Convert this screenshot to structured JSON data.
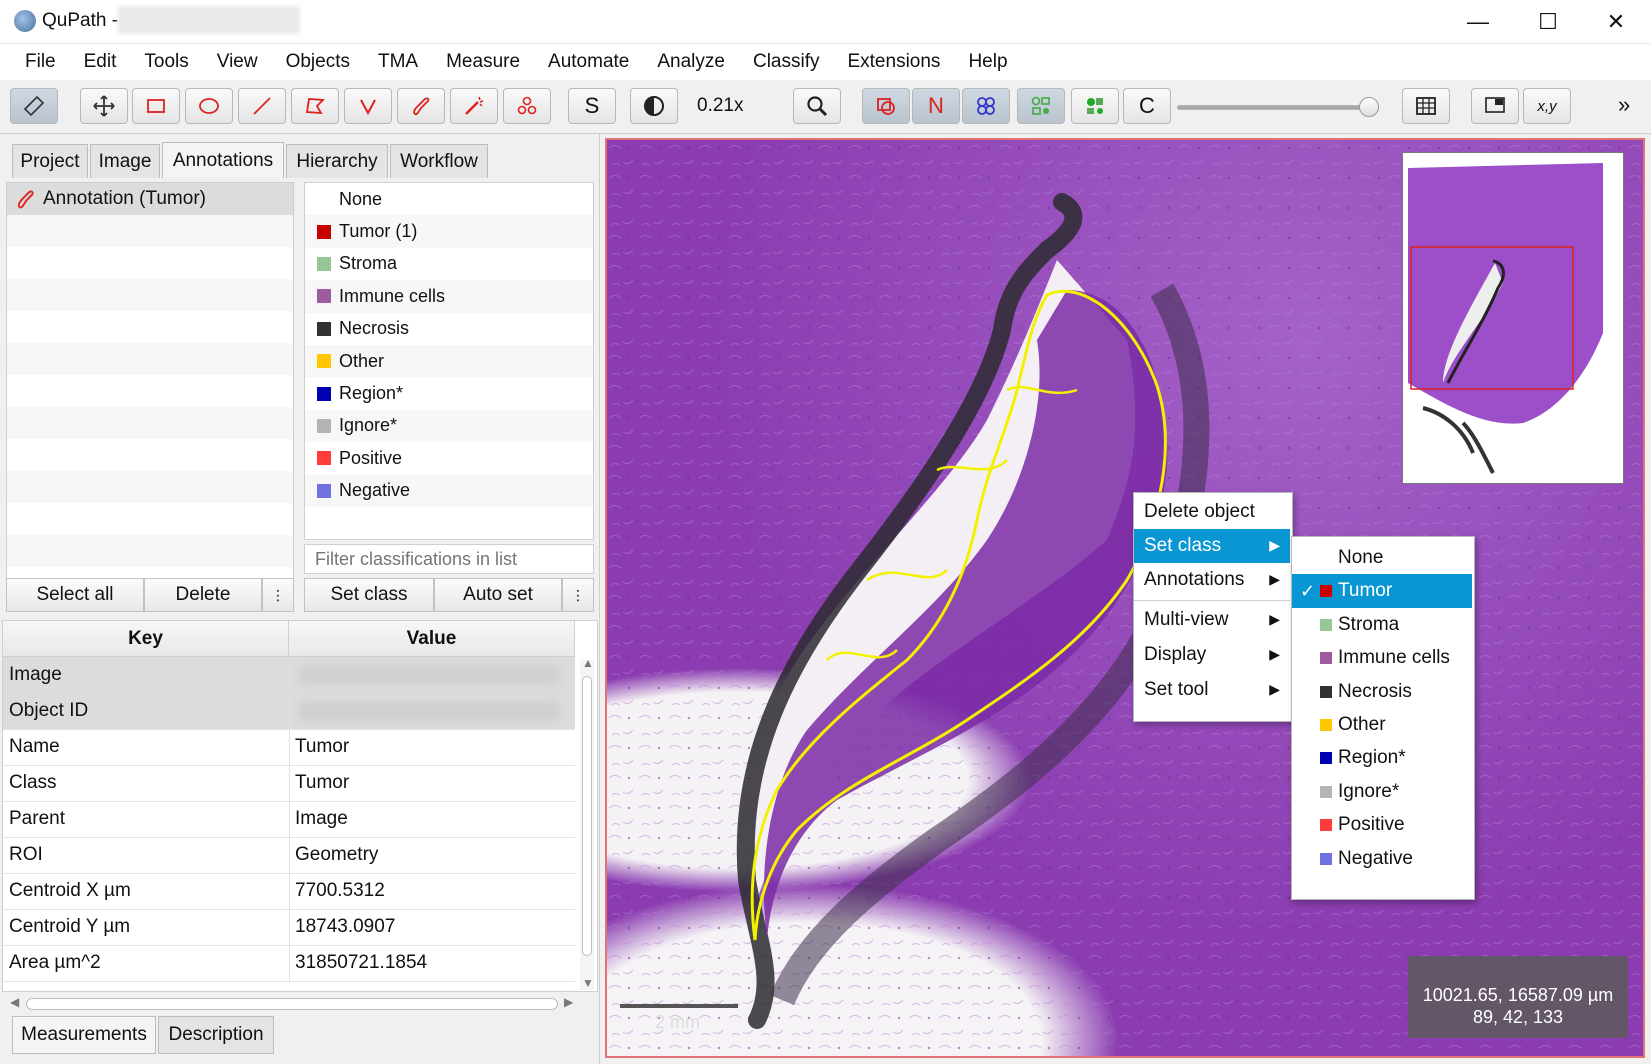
{
  "window": {
    "title": "QuPath -",
    "minimize_label": "—",
    "maximize_label": "☐",
    "close_label": "✕"
  },
  "menu": [
    "File",
    "Edit",
    "Tools",
    "View",
    "Objects",
    "TMA",
    "Measure",
    "Automate",
    "Analyze",
    "Classify",
    "Extensions",
    "Help"
  ],
  "toolbar": {
    "zoom": "0.21x",
    "s_label": "S",
    "n_label": "N",
    "c_label": "C",
    "xy_label": "x,y",
    "overflow_label": "»",
    "slider_value": 0.95
  },
  "left_tabs": [
    "Project",
    "Image",
    "Annotations",
    "Hierarchy",
    "Workflow"
  ],
  "annotations": {
    "items": [
      "Annotation (Tumor)"
    ]
  },
  "classes": [
    {
      "name": "None",
      "color": ""
    },
    {
      "name": "Tumor (1)",
      "color": "#c80000"
    },
    {
      "name": "Stroma",
      "color": "#96c896"
    },
    {
      "name": "Immune cells",
      "color": "#a05aa0"
    },
    {
      "name": "Necrosis",
      "color": "#323232"
    },
    {
      "name": "Other",
      "color": "#ffc800"
    },
    {
      "name": "Region*",
      "color": "#0000b4"
    },
    {
      "name": "Ignore*",
      "color": "#b4b4b4"
    },
    {
      "name": "Positive",
      "color": "#ff3c3c"
    },
    {
      "name": "Negative",
      "color": "#7070e0"
    }
  ],
  "class_filter_placeholder": "Filter classifications in list",
  "buttons": {
    "select_all": "Select all",
    "delete": "Delete",
    "set_class": "Set class",
    "auto_set": "Auto set",
    "more": "⋮"
  },
  "table": {
    "headers": [
      "Key",
      "Value"
    ],
    "rows": [
      {
        "key": "Image",
        "value": ""
      },
      {
        "key": "Object ID",
        "value": ""
      },
      {
        "key": "Name",
        "value": "Tumor"
      },
      {
        "key": "Class",
        "value": "Tumor"
      },
      {
        "key": "Parent",
        "value": "Image"
      },
      {
        "key": "ROI",
        "value": "Geometry"
      },
      {
        "key": "Centroid X µm",
        "value": "7700.5312"
      },
      {
        "key": "Centroid Y µm",
        "value": "18743.0907"
      },
      {
        "key": "Area µm^2",
        "value": "31850721.1854"
      }
    ]
  },
  "bottom_tabs": [
    "Measurements",
    "Description"
  ],
  "viewer": {
    "scale_label": "2 mm",
    "coords_line1": "10021.65, 16587.09 µm",
    "coords_line2": "89, 42, 133"
  },
  "context_menu": {
    "items": [
      "Delete object",
      "Set class",
      "Annotations",
      "Multi-view",
      "Display",
      "Set tool"
    ],
    "highlighted": "Set class"
  },
  "submenu": {
    "items": [
      {
        "name": "None",
        "color": ""
      },
      {
        "name": "Tumor",
        "color": "#c80000"
      },
      {
        "name": "Stroma",
        "color": "#96c896"
      },
      {
        "name": "Immune cells",
        "color": "#a05aa0"
      },
      {
        "name": "Necrosis",
        "color": "#323232"
      },
      {
        "name": "Other",
        "color": "#ffc800"
      },
      {
        "name": "Region*",
        "color": "#0000b4"
      },
      {
        "name": "Ignore*",
        "color": "#b4b4b4"
      },
      {
        "name": "Positive",
        "color": "#ff3c3c"
      },
      {
        "name": "Negative",
        "color": "#7070e0"
      }
    ],
    "checked": "Tumor",
    "check_mark": "✓"
  }
}
